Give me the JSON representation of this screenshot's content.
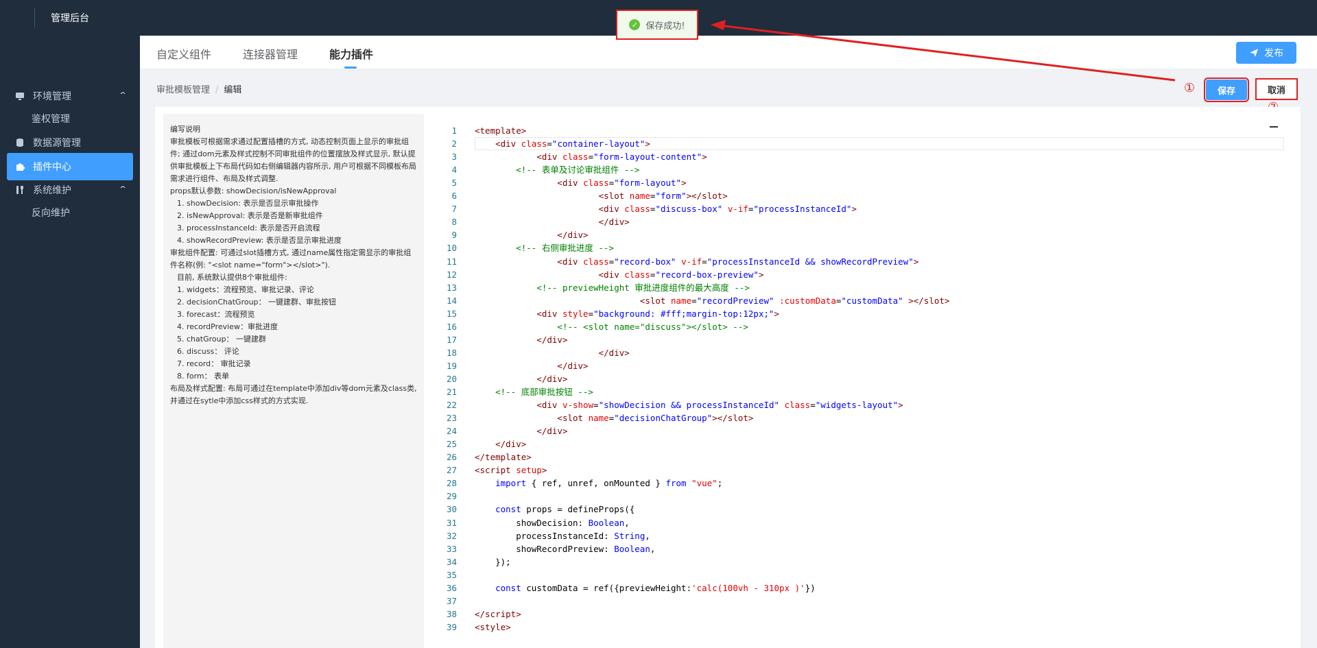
{
  "header": {
    "app_title": "管理后台"
  },
  "sidebar": {
    "items": [
      {
        "label": "环境管理",
        "chevron": "⌃"
      },
      {
        "label": "鉴权管理"
      },
      {
        "label": "数据源管理"
      },
      {
        "label": "插件中心"
      },
      {
        "label": "系统维护",
        "chevron": "⌃"
      },
      {
        "label": "反向维护"
      }
    ]
  },
  "tabs": [
    {
      "label": "自定义组件"
    },
    {
      "label": "连接器管理"
    },
    {
      "label": "能力插件"
    }
  ],
  "toolbar": {
    "publish_label": "发布",
    "save_label": "保存",
    "cancel_label": "取消"
  },
  "breadcrumb": {
    "parent": "审批模板管理",
    "separator": "/",
    "current": "编辑"
  },
  "annotations": {
    "mark1": "①",
    "mark2": "②"
  },
  "toast": {
    "message": "保存成功!"
  },
  "doc": {
    "lines": [
      "编写说明",
      "审批模板可根据需求通过配置插槽的方式, 动态控制页面上显示的审批组件; 通过dom元素及样式控制不同审批组件的位置摆放及样式显示, 默认提供审批模板上下布局代码如右侧编辑器内容所示, 用户可根据不同模板布局需求进行组件、布局及样式调整.",
      "props默认参数: showDecision/isNewApproval",
      "1. showDecision: 表示是否显示审批操作",
      "2. isNewApproval: 表示是否是新审批组件",
      "3. processInstanceId: 表示是否开启流程",
      "4. showRecordPreview: 表示是否显示审批进度",
      "审批组件配置: 可通过slot插槽方式, 通过name属性指定需显示的审批组件名称(例: \"<slot name=\"form\"></slot>\").",
      "目前, 系统默认提供8个审批组件:",
      "1. widgets：流程预览、审批记录、评论",
      "2. decisionChatGroup： 一键建群、审批按钮",
      "3. forecast：流程预览",
      "4. recordPreview：审批进度",
      "5. chatGroup： 一键建群",
      "6. discuss： 评论",
      "7. record： 审批记录",
      "8. form： 表单",
      "布局及样式配置: 布局可通过在template中添加div等dom元素及class类, 并通过在sytle中添加css样式的方式实现."
    ]
  },
  "code": [
    {
      "n": "1",
      "html": "<span class=\"t\">&lt;template&gt;</span>"
    },
    {
      "n": "2",
      "html": "    <span class=\"t\">&lt;div</span> <span class=\"a\">class</span>=<span class=\"s\">\"container-layout\"</span><span class=\"t\">&gt;</span>"
    },
    {
      "n": "3",
      "html": "            <span class=\"t\">&lt;div</span> <span class=\"a\">class</span>=<span class=\"s\">\"form-layout-content\"</span><span class=\"t\">&gt;</span>"
    },
    {
      "n": "4",
      "html": "        <span class=\"c\">&lt;!-- 表单及讨论审批组件 --&gt;</span>"
    },
    {
      "n": "5",
      "html": "                <span class=\"t\">&lt;div</span> <span class=\"a\">class</span>=<span class=\"s\">\"form-layout\"</span><span class=\"t\">&gt;</span>"
    },
    {
      "n": "6",
      "html": "                        <span class=\"t\">&lt;slot</span> <span class=\"a\">name</span>=<span class=\"s\">\"form\"</span><span class=\"t\">&gt;&lt;/slot&gt;</span>"
    },
    {
      "n": "7",
      "html": "                        <span class=\"t\">&lt;div</span> <span class=\"a\">class</span>=<span class=\"s\">\"discuss-box\"</span> <span class=\"a\">v-if</span>=<span class=\"s\">\"processInstanceId\"</span><span class=\"t\">&gt;</span>"
    },
    {
      "n": "8",
      "html": "                        <span class=\"t\">&lt;/div&gt;</span>"
    },
    {
      "n": "9",
      "html": "                <span class=\"t\">&lt;/div&gt;</span>"
    },
    {
      "n": "10",
      "html": "        <span class=\"c\">&lt;!-- 右侧审批进度 --&gt;</span>"
    },
    {
      "n": "11",
      "html": "                <span class=\"t\">&lt;div</span> <span class=\"a\">class</span>=<span class=\"s\">\"record-box\"</span> <span class=\"a\">v-if</span>=<span class=\"s\">\"processInstanceId &amp;&amp; showRecordPreview\"</span><span class=\"t\">&gt;</span>"
    },
    {
      "n": "12",
      "html": "                        <span class=\"t\">&lt;div</span> <span class=\"a\">class</span>=<span class=\"s\">\"record-box-preview\"</span><span class=\"t\">&gt;</span>"
    },
    {
      "n": "13",
      "html": "            <span class=\"c\">&lt;!-- previewHeight 审批进度组件的最大高度 --&gt;</span>"
    },
    {
      "n": "14",
      "html": "                                <span class=\"t\">&lt;slot</span> <span class=\"a\">name</span>=<span class=\"s\">\"recordPreview\"</span> <span class=\"a\">:customData</span>=<span class=\"s\">\"customData\"</span> <span class=\"t\">&gt;&lt;/slot&gt;</span>"
    },
    {
      "n": "15",
      "html": "            <span class=\"t\">&lt;div</span> <span class=\"a\">style</span>=<span class=\"s\">\"background: #fff;margin-top:12px;\"</span><span class=\"t\">&gt;</span>"
    },
    {
      "n": "16",
      "html": "                <span class=\"c\">&lt;!-- &lt;slot name=\"discuss\"&gt;&lt;/slot&gt; --&gt;</span>"
    },
    {
      "n": "17",
      "html": "            <span class=\"t\">&lt;/div&gt;</span>"
    },
    {
      "n": "18",
      "html": "                        <span class=\"t\">&lt;/div&gt;</span>"
    },
    {
      "n": "19",
      "html": "                <span class=\"t\">&lt;/div&gt;</span>"
    },
    {
      "n": "20",
      "html": "            <span class=\"t\">&lt;/div&gt;</span>"
    },
    {
      "n": "21",
      "html": "    <span class=\"c\">&lt;!-- 底部审批按钮 --&gt;</span>"
    },
    {
      "n": "22",
      "html": "            <span class=\"t\">&lt;div</span> <span class=\"a\">v-show</span>=<span class=\"s\">\"showDecision &amp;&amp; processInstanceId\"</span> <span class=\"a\">class</span>=<span class=\"s\">\"widgets-layout\"</span><span class=\"t\">&gt;</span>"
    },
    {
      "n": "23",
      "html": "                <span class=\"t\">&lt;slot</span> <span class=\"a\">name</span>=<span class=\"s\">\"decisionChatGroup\"</span><span class=\"t\">&gt;&lt;/slot&gt;</span>"
    },
    {
      "n": "24",
      "html": "            <span class=\"t\">&lt;/div&gt;</span>"
    },
    {
      "n": "25",
      "html": "    <span class=\"t\">&lt;/div&gt;</span>"
    },
    {
      "n": "26",
      "html": "<span class=\"t\">&lt;/template&gt;</span>"
    },
    {
      "n": "27",
      "html": "<span class=\"t\">&lt;script</span> <span class=\"a\">setup</span><span class=\"t\">&gt;</span>"
    },
    {
      "n": "28",
      "html": "    <span class=\"k\">import</span> { ref, unref, onMounted } <span class=\"k\">from</span> <span class=\"a\">\"vue\"</span>;"
    },
    {
      "n": "29",
      "html": ""
    },
    {
      "n": "30",
      "html": "    <span class=\"k\">const</span> props = defineProps({"
    },
    {
      "n": "31",
      "html": "        showDecision: <span class=\"s\">Boolean</span>,"
    },
    {
      "n": "32",
      "html": "        processInstanceId: <span class=\"s\">String</span>,"
    },
    {
      "n": "33",
      "html": "        showRecordPreview: <span class=\"s\">Boolean</span>,"
    },
    {
      "n": "34",
      "html": "    });"
    },
    {
      "n": "35",
      "html": ""
    },
    {
      "n": "36",
      "html": "    <span class=\"k\">const</span> customData = ref({previewHeight:<span class=\"a\">'calc(100vh - 310px )'</span>})"
    },
    {
      "n": "37",
      "html": ""
    },
    {
      "n": "38",
      "html": "<span class=\"t\">&lt;/script&gt;</span>"
    },
    {
      "n": "39",
      "html": "<span class=\"t\">&lt;style&gt;</span>"
    }
  ],
  "colors": {
    "accent": "#409eff",
    "sidebar_bg": "#1f2d3d",
    "highlight": "#e02020",
    "success": "#67c23a"
  },
  "icons": [
    "monitor-icon",
    "database-icon",
    "puzzle-icon",
    "tools-icon",
    "send-icon",
    "check-circle-icon",
    "minimize-icon"
  ]
}
